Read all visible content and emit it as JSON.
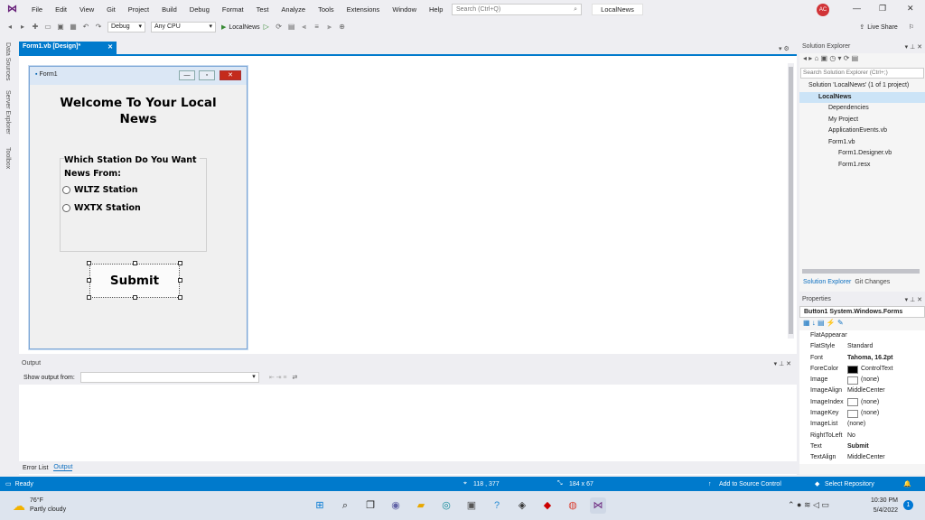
{
  "menu": {
    "items": [
      "File",
      "Edit",
      "View",
      "Git",
      "Project",
      "Build",
      "Debug",
      "Format",
      "Test",
      "Analyze",
      "Tools",
      "Extensions",
      "Window",
      "Help"
    ],
    "search_placeholder": "Search (Ctrl+Q)",
    "project_title": "LocalNews",
    "avatar": "AC",
    "live_share": "Live Share"
  },
  "toolbar": {
    "config": "Debug",
    "platform": "Any CPU",
    "run_target": "LocalNews"
  },
  "sidebar": {
    "tabs": [
      "Data Sources",
      "Server Explorer",
      "Toolbox"
    ]
  },
  "document_tab": {
    "label": "Form1.vb [Design]*"
  },
  "form": {
    "title": "Form1",
    "welcome": "Welcome To Your Local News",
    "question": "Which Station Do You Want News From:",
    "radios": [
      "WLTZ Station",
      "WXTX Station"
    ],
    "submit": "Submit"
  },
  "output": {
    "title": "Output",
    "show_from": "Show output from:",
    "tabs": [
      "Error List",
      "Output"
    ]
  },
  "solution_explorer": {
    "title": "Solution Explorer",
    "search_placeholder": "Search Solution Explorer (Ctrl+;)",
    "tree": [
      {
        "label": "Solution 'LocalNews' (1 of 1 project)",
        "level": 0
      },
      {
        "label": "LocalNews",
        "level": 1,
        "bold": true
      },
      {
        "label": "Dependencies",
        "level": 2
      },
      {
        "label": "My Project",
        "level": 2
      },
      {
        "label": "ApplicationEvents.vb",
        "level": 2
      },
      {
        "label": "Form1.vb",
        "level": 2
      },
      {
        "label": "Form1.Designer.vb",
        "level": 3
      },
      {
        "label": "Form1.resx",
        "level": 3
      }
    ],
    "tabs": [
      "Solution Explorer",
      "Git Changes"
    ]
  },
  "properties": {
    "title": "Properties",
    "object": "Button1 System.Windows.Forms",
    "rows": [
      {
        "k": "FlatAppearance",
        "v": ""
      },
      {
        "k": "FlatStyle",
        "v": "Standard"
      },
      {
        "k": "Font",
        "v": "Tahoma, 16.2pt",
        "bold": true
      },
      {
        "k": "ForeColor",
        "v": "ControlText",
        "swatch": "#000000"
      },
      {
        "k": "Image",
        "v": "(none)",
        "swatch": "#ffffff"
      },
      {
        "k": "ImageAlign",
        "v": "MiddleCenter"
      },
      {
        "k": "ImageIndex",
        "v": "(none)",
        "swatch": "#ffffff"
      },
      {
        "k": "ImageKey",
        "v": "(none)",
        "swatch": "#ffffff"
      },
      {
        "k": "ImageList",
        "v": "(none)"
      },
      {
        "k": "RightToLeft",
        "v": "No"
      },
      {
        "k": "Text",
        "v": "Submit",
        "bold": true
      },
      {
        "k": "TextAlign",
        "v": "MiddleCenter"
      }
    ]
  },
  "status": {
    "ready": "Ready",
    "position": "118 , 377",
    "size": "184 x 67",
    "source_control": "Add to Source Control",
    "repo": "Select Repository"
  },
  "taskbar": {
    "temp": "76°F",
    "weather": "Partly cloudy",
    "time": "10:30 PM",
    "date": "5/4/2022"
  },
  "colors": {
    "accent": "#007acc",
    "vs_purple": "#68217a"
  }
}
